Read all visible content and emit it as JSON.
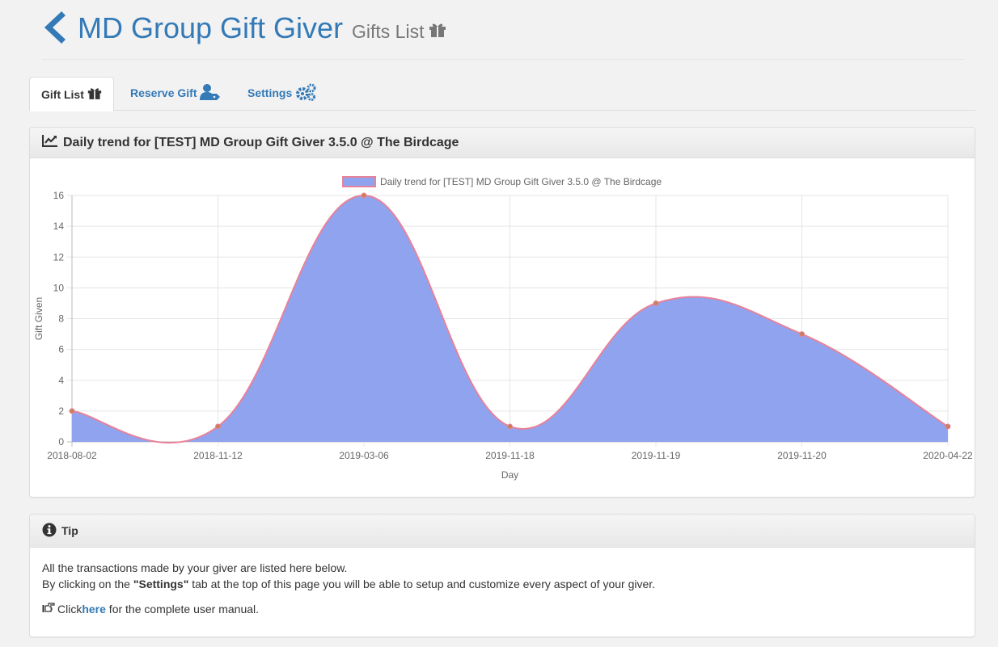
{
  "header": {
    "title": "MD Group Gift Giver",
    "subtitle": "Gifts List"
  },
  "tabs": [
    {
      "label": "Gift List",
      "icon": "gift-icon",
      "active": true
    },
    {
      "label": "Reserve Gift",
      "icon": "user-tag-icon",
      "active": false
    },
    {
      "label": "Settings",
      "icon": "gears-icon",
      "active": false
    }
  ],
  "chart_panel": {
    "heading": "Daily trend for [TEST] MD Group Gift Giver 3.5.0 @ The Birdcage",
    "icon": "line-chart-icon"
  },
  "chart_data": {
    "type": "area",
    "x": [
      "2018-08-02",
      "2018-11-12",
      "2019-03-06",
      "2019-11-18",
      "2019-11-19",
      "2019-11-20",
      "2020-04-22"
    ],
    "series": [
      {
        "name": "Daily trend for [TEST] MD Group Gift Giver 3.5.0 @ The Birdcage",
        "values": [
          2,
          1,
          16,
          1,
          9,
          7,
          1
        ]
      }
    ],
    "xlabel": "Day",
    "ylabel": "Gift Given",
    "ylim": [
      0,
      16
    ],
    "yticks": [
      0,
      2,
      4,
      6,
      8,
      10,
      12,
      14,
      16
    ],
    "grid": true,
    "legend": "top-center",
    "colors": {
      "fill": "#8fa3ef",
      "line": "#e8829a",
      "point": "#c9805a"
    }
  },
  "tip_panel": {
    "heading": "Tip",
    "icon": "info-circle-icon",
    "line1": "All the transactions made by your giver are listed here below.",
    "line2_before": "By clicking on the ",
    "line2_bold": "\"Settings\"",
    "line2_after": " tab at the top of this page you will be able to setup and customize every aspect of your giver.",
    "line3_before": "Click ",
    "line3_link": "here",
    "line3_after": " for the complete user manual.",
    "hand_icon": "hand-pointing-icon"
  },
  "colors": {
    "accent": "#337ab7",
    "background": "#f2f2f2"
  }
}
